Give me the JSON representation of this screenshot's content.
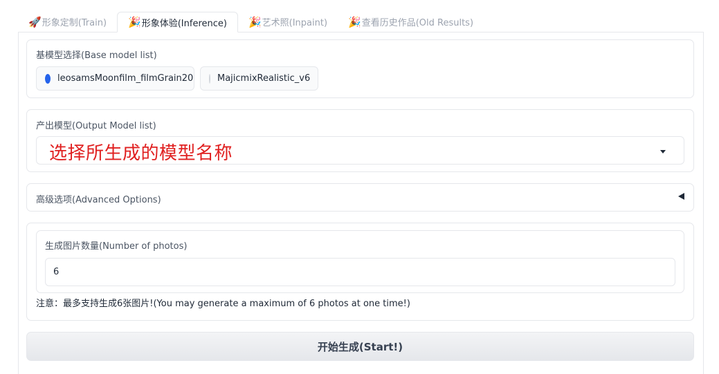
{
  "tabs": [
    {
      "emoji": "🚀",
      "label": "形象定制(Train)"
    },
    {
      "emoji": "🎉",
      "label": "形象体验(Inference)"
    },
    {
      "emoji": "🎉",
      "label": "艺术照(Inpaint)"
    },
    {
      "emoji": "🎉",
      "label": "查看历史作品(Old Results)"
    }
  ],
  "active_tab": 1,
  "base_model": {
    "label": "基模型选择(Base model list)",
    "options": [
      "leosamsMoonfilm_filmGrain20",
      "MajicmixRealistic_v6"
    ],
    "selected": "leosamsMoonfilm_filmGrain20"
  },
  "output_model": {
    "label": "产出模型(Output Model list)",
    "value": "选择所生成的模型名称"
  },
  "advanced": {
    "label": "高级选项(Advanced Options)",
    "expanded": false
  },
  "photos": {
    "label": "生成图片数量(Number of photos)",
    "value": "6",
    "note": "注意：最多支持生成6张图片!(You may generate a maximum of 6 photos at one time!)"
  },
  "start_button": "开始生成(Start!)",
  "colors": {
    "accent": "#2563eb",
    "highlight_text": "#e02020"
  }
}
